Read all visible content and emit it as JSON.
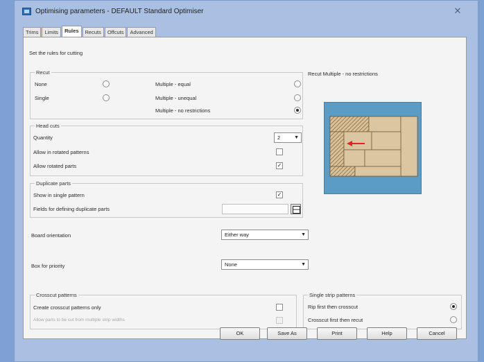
{
  "window": {
    "title": "Optimising parameters - DEFAULT Standard Optimiser",
    "close_glyph": "✕"
  },
  "tabs": [
    "Trims",
    "Limits",
    "Rules",
    "Recuts",
    "Offcuts",
    "Advanced"
  ],
  "active_tab": "Rules",
  "intro": "Set the rules for cutting",
  "recut": {
    "title": "Recut",
    "options": [
      {
        "label": "None",
        "selected": false
      },
      {
        "label": "Single",
        "selected": false
      },
      {
        "label": "Multiple - equal",
        "selected": false
      },
      {
        "label": "Multiple - unequal",
        "selected": false
      },
      {
        "label": "Multiple - no restrictions",
        "selected": true
      }
    ]
  },
  "head_cuts": {
    "title": "Head cuts",
    "quantity_label": "Quantity",
    "quantity_value": "2",
    "allow_rotated_patterns": "Allow in rotated patterns",
    "allow_rotated_patterns_checked": false,
    "allow_rotated_parts": "Allow rotated parts",
    "allow_rotated_parts_checked": true
  },
  "duplicate_parts": {
    "title": "Duplicate parts",
    "show_single_label": "Show in single pattern",
    "show_single_checked": true,
    "fields_label": "Fields for defining duplicate parts",
    "fields_value": ""
  },
  "board_orientation": {
    "label": "Board orientation",
    "value": "Either way"
  },
  "box_priority": {
    "label": "Box for priority",
    "value": "None"
  },
  "crosscut": {
    "title": "Crosscut patterns",
    "create_only_label": "Create crosscut patterns only",
    "create_only_checked": false,
    "multiple_strip_label": "Allow parts to be cut from multiple strip widths",
    "multiple_strip_checked": false
  },
  "single_strip": {
    "title": "Single strip patterns",
    "options": [
      {
        "label": "Rip first then crosscut",
        "selected": true
      },
      {
        "label": "Crosscut first then recut",
        "selected": false
      }
    ]
  },
  "preview": {
    "caption": "Recut Multiple - no restrictions",
    "board_color": "#5b9cc6",
    "part_color": "#d9c19c",
    "hatch_color": "#8a6a3c",
    "arrow_color": "#e02424"
  },
  "buttons": {
    "ok": "OK",
    "save_as": "Save As",
    "print": "Print",
    "help": "Help",
    "cancel": "Cancel"
  }
}
